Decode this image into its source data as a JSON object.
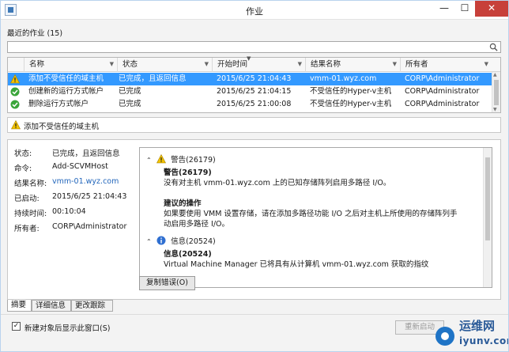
{
  "window": {
    "title": "作业",
    "minimize": "—",
    "maximize": "☐",
    "close": "✕"
  },
  "recent_label": "最近的作业 (15)",
  "columns": {
    "name": "名称",
    "status": "状态",
    "start_time": "开始时间",
    "result_name": "结果名称",
    "owner": "所有者"
  },
  "rows": [
    {
      "icon": "warning-icon",
      "name": "添加不受信任的域主机",
      "status": "已完成，且返回信息",
      "start": "2015/6/25 21:04:43",
      "result": "vmm-01.wyz.com",
      "owner": "CORP\\Administrator"
    },
    {
      "icon": "success-icon",
      "name": "创建新的运行方式帐户",
      "status": "已完成",
      "start": "2015/6/25 21:04:15",
      "result": "不受信任的Hyper-v主机",
      "owner": "CORP\\Administrator"
    },
    {
      "icon": "success-icon",
      "name": "删除运行方式帐户",
      "status": "已完成",
      "start": "2015/6/25 21:00:08",
      "result": "不受信任的Hyper-v主机",
      "owner": "CORP\\Administrator"
    }
  ],
  "selected_job": "添加不受信任的域主机",
  "details": {
    "status_label": "状态:",
    "status": "已完成，且返回信息",
    "command_label": "命令:",
    "command": "Add-SCVMHost",
    "result_label": "结果名称:",
    "result": "vmm-01.wyz.com",
    "started_label": "已启动:",
    "started": "2015/6/25 21:04:43",
    "duration_label": "持续时间:",
    "duration": "00:10:04",
    "owner_label": "所有者:",
    "owner": "CORP\\Administrator"
  },
  "messages": {
    "warning_header": "警告(26179)",
    "warning_title": "警告(26179)",
    "warning_text": "没有对主机 vmm-01.wyz.com 上的已知存储阵列启用多路径 I/O。",
    "action_title": "建议的操作",
    "action_line1": "如果要使用 VMM 设置存储，请在添加多路径功能 I/O 之后对主机上所使用的存储阵列手",
    "action_line2": "动启用多路径 I/O。",
    "info_header": "信息(20524)",
    "info_title": "信息(20524)",
    "info_text": "Virtual Machine Manager 已将具有从计算机 vmm-01.wyz.com 获取的指纹"
  },
  "copy_button": "复制错误(O)",
  "tabs": [
    "摘要",
    "详细信息",
    "更改跟踪"
  ],
  "show_window_checkbox": "新建对象后显示此窗口(S)",
  "restart_button": "重新启动",
  "watermark": {
    "cn": "运维网",
    "en": "iyunv.com"
  },
  "colors": {
    "selection": "#3399ff",
    "link": "#2266bb",
    "close": "#c7403a",
    "warning": "#f2c200",
    "success": "#3aa53a",
    "info": "#2f6fd1"
  }
}
